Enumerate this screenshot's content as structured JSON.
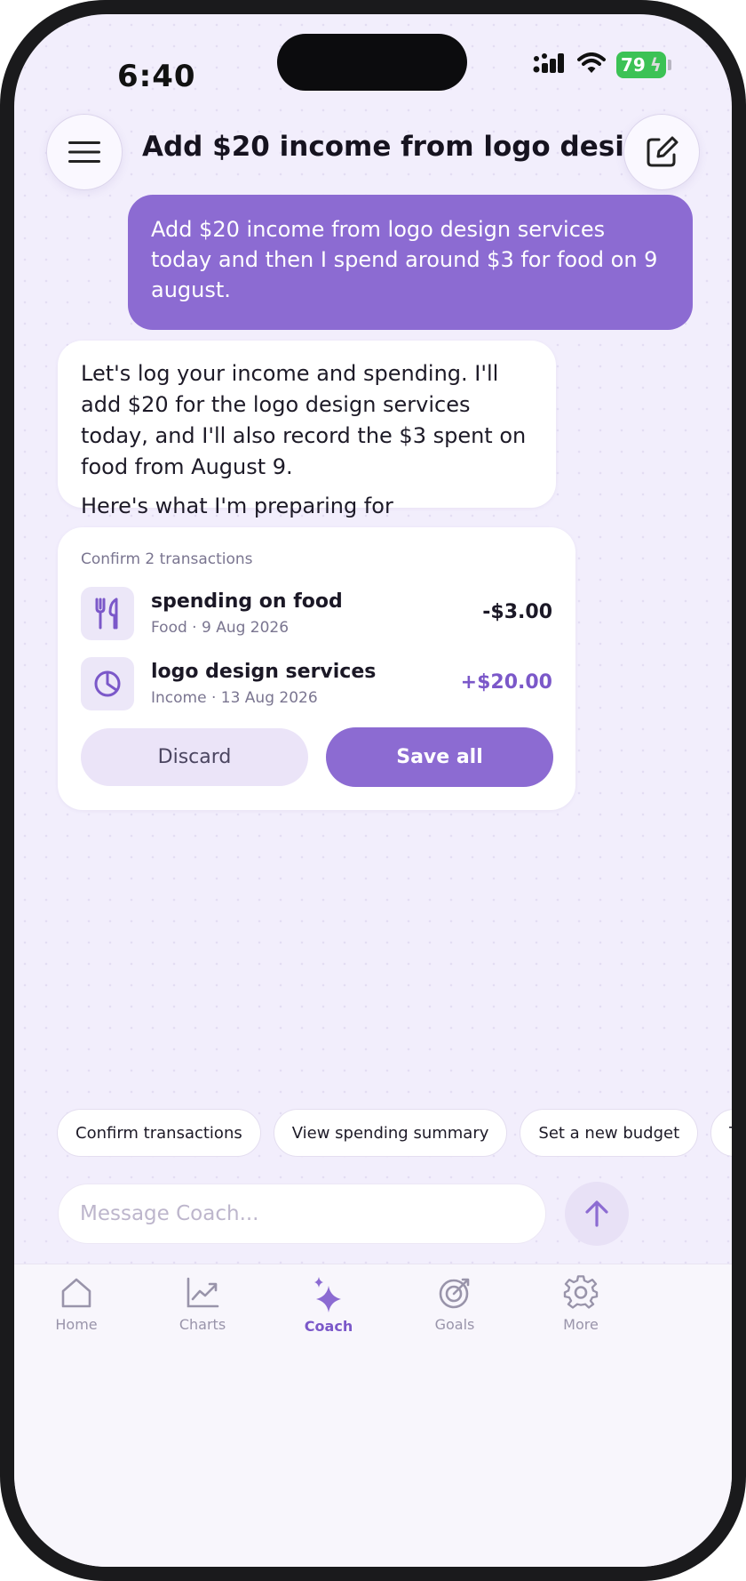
{
  "status_bar": {
    "time": "6:40",
    "battery": "79"
  },
  "header": {
    "title": "Add $20 income from logo desi..."
  },
  "user_message": {
    "text": "Add $20 income from logo design services today and then I spend around $3 for food on 9 august."
  },
  "assistant_message": {
    "paragraphs": [
      "Let's log your income and spending. I'll add $20 for the logo design services today, and I'll also record the $3 spent on food from August 9.",
      "Here's what I'm preparing for confirmation:"
    ]
  },
  "confirm_card": {
    "label": "Confirm 2 transactions",
    "transactions": [
      {
        "name": "spending on food",
        "meta": "Food · 9 Aug 2026",
        "amount": "-$3.00",
        "type": "expense",
        "icon": "fork-knife-icon"
      },
      {
        "name": "logo design services",
        "meta": "Income · 13 Aug 2026",
        "amount": "+$20.00",
        "type": "income",
        "icon": "pie-chart-icon"
      }
    ],
    "discard_label": "Discard",
    "save_label": "Save all"
  },
  "suggestions": [
    "Confirm transactions",
    "View spending summary",
    "Set a new budget",
    "T"
  ],
  "composer": {
    "placeholder": "Message Coach..."
  },
  "tabs": [
    {
      "label": "Home",
      "icon": "home-icon",
      "active": false
    },
    {
      "label": "Charts",
      "icon": "chart-icon",
      "active": false
    },
    {
      "label": "Coach",
      "icon": "sparkle-icon",
      "active": true
    },
    {
      "label": "Goals",
      "icon": "target-icon",
      "active": false
    },
    {
      "label": "More",
      "icon": "gear-icon",
      "active": false
    }
  ],
  "colors": {
    "accent": "#8c6bd2",
    "accent_text": "#7b58c9",
    "background": "#f2eefc",
    "battery": "#3cc255"
  }
}
